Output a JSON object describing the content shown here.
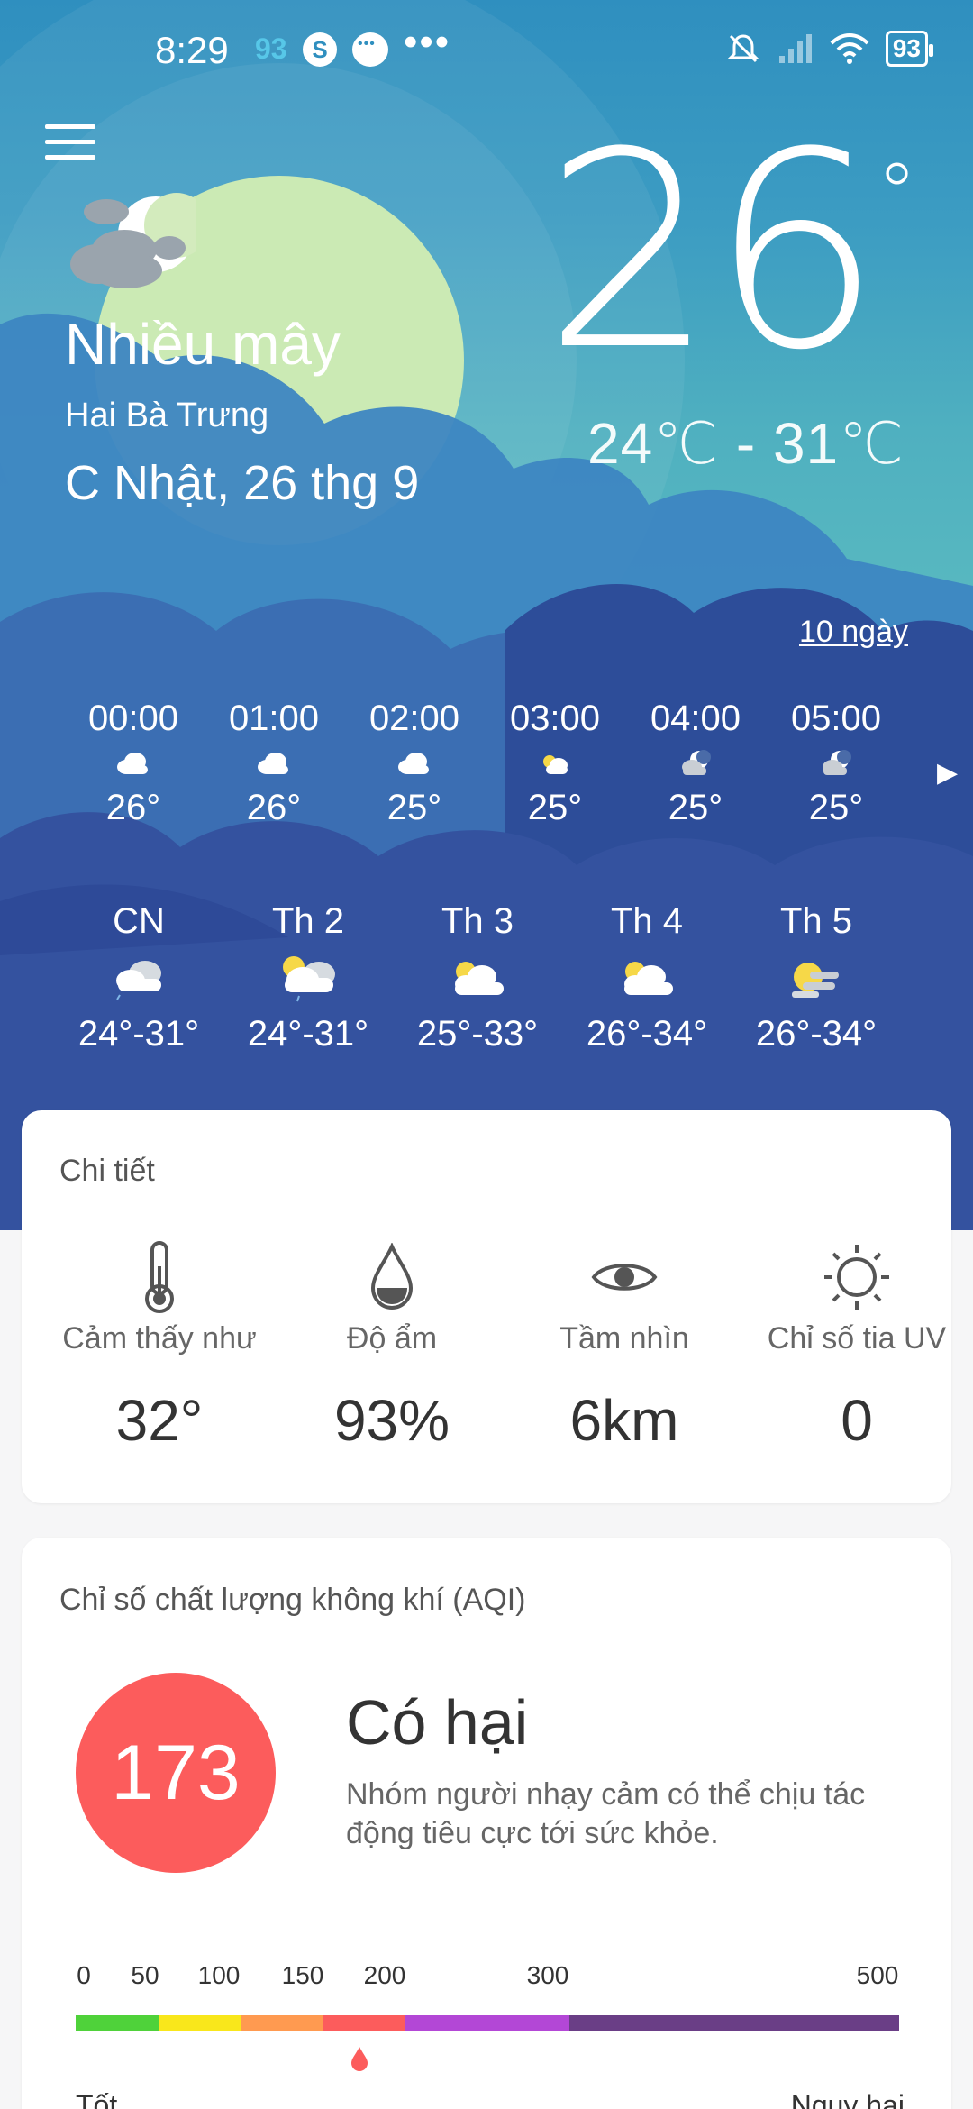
{
  "status_bar": {
    "time": "8:29",
    "notif_count": "93",
    "battery": "93"
  },
  "current": {
    "condition": "Nhiều mây",
    "location": "Hai Bà Trưng",
    "date": "C Nhật, 26 thg 9",
    "temperature": "26",
    "degree": "°",
    "range": "24℃ - 31℃",
    "icon": "partly-cloudy-night-icon"
  },
  "ten_days_link": "10 ngày",
  "hourly": [
    {
      "time": "00:00",
      "temp": "26°",
      "icon": "cloud-icon"
    },
    {
      "time": "01:00",
      "temp": "26°",
      "icon": "cloud-icon"
    },
    {
      "time": "02:00",
      "temp": "25°",
      "icon": "cloud-icon"
    },
    {
      "time": "03:00",
      "temp": "25°",
      "icon": "cloud-sun-icon"
    },
    {
      "time": "04:00",
      "temp": "25°",
      "icon": "cloud-moon-icon"
    },
    {
      "time": "05:00",
      "temp": "25°",
      "icon": "cloud-moon-icon"
    }
  ],
  "daily": [
    {
      "day": "CN",
      "range": "24°-31°",
      "icon": "cloud-rain-icon"
    },
    {
      "day": "Th 2",
      "range": "24°-31°",
      "icon": "sun-cloud-rain-icon"
    },
    {
      "day": "Th 3",
      "range": "25°-33°",
      "icon": "sun-cloud-icon"
    },
    {
      "day": "Th 4",
      "range": "26°-34°",
      "icon": "sun-cloud-icon"
    },
    {
      "day": "Th 5",
      "range": "26°-34°",
      "icon": "sun-haze-icon"
    }
  ],
  "details": {
    "title": "Chi tiết",
    "items": [
      {
        "label": "Cảm thấy như",
        "value": "32°",
        "icon": "thermometer-icon"
      },
      {
        "label": "Độ ẩm",
        "value": "93%",
        "icon": "droplet-icon"
      },
      {
        "label": "Tầm nhìn",
        "value": "6km",
        "icon": "eye-icon"
      },
      {
        "label": "Chỉ số tia UV",
        "value": "0",
        "icon": "sun-icon"
      }
    ]
  },
  "aqi": {
    "title": "Chỉ số chất lượng không khí (AQI)",
    "value": "173",
    "level": "Có hại",
    "description": "Nhóm người nhạy cảm có thể chịu tác động tiêu cực tới sức khỏe.",
    "scale_ticks": [
      "0",
      "50",
      "100",
      "150",
      "200",
      "300",
      "500"
    ],
    "scale_colors": [
      "#4fd23a",
      "#f9e71b",
      "#ff9a50",
      "#fc5c5c",
      "#b347d6",
      "#6a3e86"
    ],
    "min_label": "Tốt",
    "max_label": "Nguy hại",
    "accent": "#fc5c5c"
  }
}
